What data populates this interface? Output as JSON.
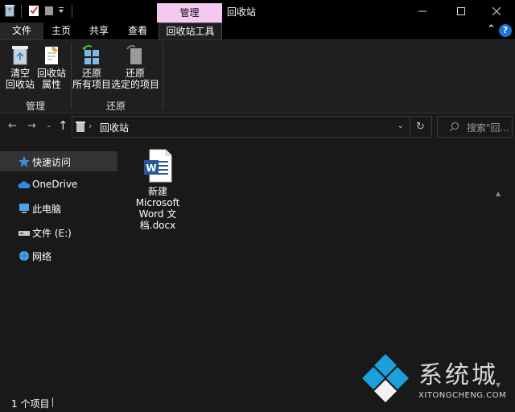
{
  "titlebar": {
    "context_tab": "管理",
    "title": "回收站",
    "buttons": [
      "minimize-icon",
      "maximize-icon",
      "close-icon"
    ]
  },
  "tabs": {
    "file": "文件",
    "home": "主页",
    "share": "共享",
    "view": "查看",
    "recycle_tools": "回收站工具"
  },
  "ribbon": {
    "empty_line1": "清空",
    "empty_line2": "回收站",
    "props_line1": "回收站",
    "props_line2": "属性",
    "group_manage": "管理",
    "restore_all_line1": "还原",
    "restore_all_line2": "所有项目",
    "restore_sel_line1": "还原",
    "restore_sel_line2": "选定的项目",
    "group_restore": "还原"
  },
  "address": {
    "path": "回收站",
    "search_placeholder": "搜索\"回..."
  },
  "sidebar": {
    "items": [
      {
        "label": "快速访问",
        "icon": "star-icon"
      },
      {
        "label": "OneDrive",
        "icon": "cloud-icon"
      },
      {
        "label": "此电脑",
        "icon": "computer-icon"
      },
      {
        "label": "文件 (E:)",
        "icon": "drive-icon"
      },
      {
        "label": "网络",
        "icon": "network-icon"
      }
    ]
  },
  "content": {
    "files": [
      {
        "name": "新建 Microsoft Word 文档.docx",
        "icon": "word-document-icon"
      }
    ]
  },
  "status": {
    "count": "1 个项目"
  },
  "watermark": {
    "title": "系统城",
    "subtitle": "XITONGCHENG.COM"
  },
  "colors": {
    "background": "#191919",
    "context_tab": "#f4c8f0",
    "accent_blue": "#1e73d8"
  }
}
